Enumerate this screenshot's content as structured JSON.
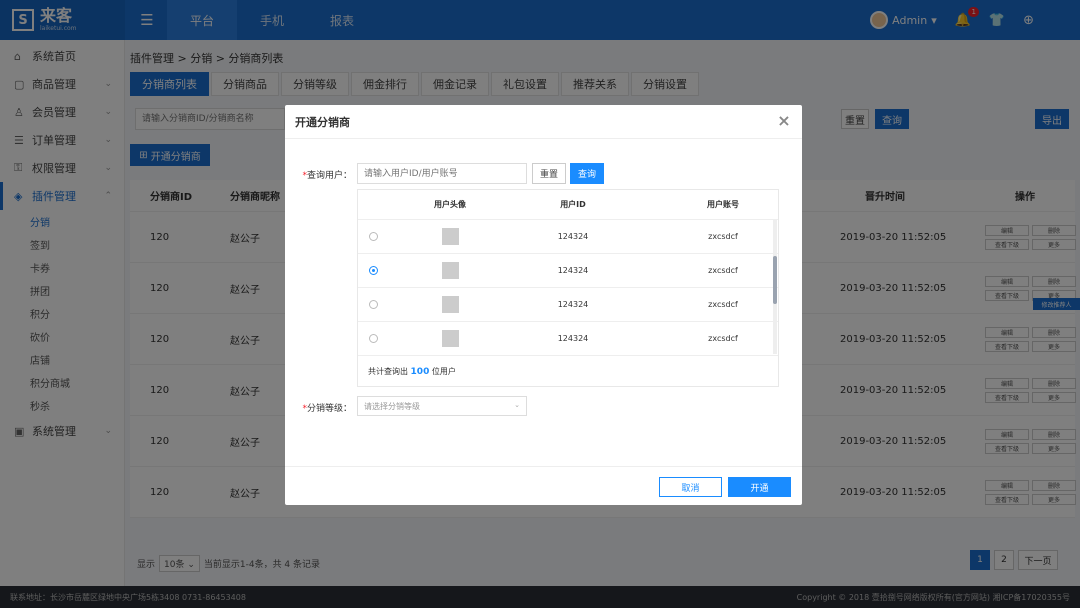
{
  "app": {
    "logo_text": "来客",
    "logo_sub": "laiketui.com",
    "top_nav": [
      "平台",
      "手机",
      "报表"
    ],
    "user": "Admin",
    "notice_count": "1"
  },
  "sidebar": {
    "items": [
      {
        "label": "系统首页",
        "icon": "home-icon"
      },
      {
        "label": "商品管理",
        "icon": "goods-icon"
      },
      {
        "label": "会员管理",
        "icon": "user-icon"
      },
      {
        "label": "订单管理",
        "icon": "order-icon"
      },
      {
        "label": "权限管理",
        "icon": "lock-icon"
      },
      {
        "label": "插件管理",
        "icon": "plugin-icon"
      }
    ],
    "subitems": [
      "分销",
      "签到",
      "卡券",
      "拼团",
      "积分",
      "砍价",
      "店铺",
      "积分商城",
      "秒杀"
    ],
    "last": {
      "label": "系统管理",
      "icon": "settings-icon"
    }
  },
  "content": {
    "breadcrumb": "插件管理 > 分销 > 分销商列表",
    "tabs": [
      "分销商列表",
      "分销商品",
      "分销等级",
      "佣金排行",
      "佣金记录",
      "礼包设置",
      "推荐关系",
      "分销设置"
    ],
    "search_placeholder": "请输入分销商ID/分销商名称",
    "reset": "重置",
    "query": "查询",
    "export": "导出",
    "open_button": "开通分销商",
    "columns": {
      "id": "分销商ID",
      "name": "分销商昵称",
      "time": "晋升时间",
      "op": "操作"
    },
    "rows": [
      {
        "id": "120",
        "name": "赵公子",
        "time": "2019-03-20 11:52:05"
      },
      {
        "id": "120",
        "name": "赵公子",
        "time": "2019-03-20 11:52:05"
      },
      {
        "id": "120",
        "name": "赵公子",
        "time": "2019-03-20 11:52:05"
      },
      {
        "id": "120",
        "name": "赵公子",
        "time": "2019-03-20 11:52:05"
      },
      {
        "id": "120",
        "name": "赵公子",
        "time": "2019-03-20 11:52:05"
      },
      {
        "id": "120",
        "name": "赵公子",
        "time": "2019-03-20 11:52:05"
      }
    ],
    "ops": {
      "edit": "编辑",
      "delete": "删除",
      "sub": "查看下级",
      "more": "更多"
    },
    "tip": "修改推荐人",
    "pager": {
      "show": "显示",
      "size": "10条",
      "summary": "当前显示1-4条，共 4 条记录",
      "page1": "1",
      "page2": "2",
      "next": "下一页"
    }
  },
  "footer": {
    "left": "联系地址：长沙市岳麓区绿地中央广场5栋3408    0731-86453408",
    "right": "Copyright © 2018 壹拾捌号网络版权所有(官方网站)  湘ICP备17020355号"
  },
  "modal": {
    "title": "开通分销商",
    "query_label": "查询用户：",
    "query_placeholder": "请输入用户ID/用户账号",
    "reset": "重置",
    "query": "查询",
    "table_headers": {
      "avatar": "用户头像",
      "id": "用户ID",
      "account": "用户账号"
    },
    "users": [
      {
        "id": "124324",
        "account": "zxcsdcf",
        "checked": false
      },
      {
        "id": "124324",
        "account": "zxcsdcf",
        "checked": true
      },
      {
        "id": "124324",
        "account": "zxcsdcf",
        "checked": false
      },
      {
        "id": "124324",
        "account": "zxcsdcf",
        "checked": false
      }
    ],
    "total_prefix": "共计查询出",
    "total_count": "100",
    "total_suffix": "位用户",
    "level_label": "分销等级：",
    "level_placeholder": "请选择分销等级",
    "cancel": "取消",
    "confirm": "开通"
  }
}
